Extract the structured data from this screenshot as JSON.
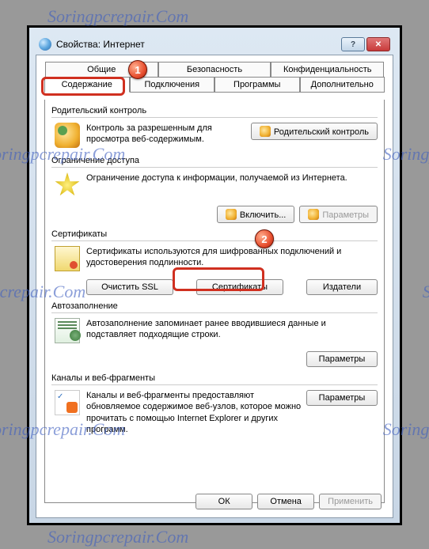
{
  "watermark": "Soringpcrepair.Com",
  "title": "Свойства: Интернет",
  "callouts": {
    "one": "1",
    "two": "2"
  },
  "tabs": {
    "general": "Общие",
    "security": "Безопасность",
    "privacy": "Конфиденциальность",
    "content": "Содержание",
    "connections": "Подключения",
    "programs": "Программы",
    "advanced": "Дополнительно"
  },
  "parental": {
    "header": "Родительский контроль",
    "text": "Контроль за разрешенным для просмотра веб-содержимым.",
    "button": "Родительский контроль"
  },
  "restrict": {
    "header": "Ограничение доступа",
    "text": "Ограничение доступа к информации, получаемой из Интернета.",
    "enable": "Включить...",
    "params": "Параметры"
  },
  "certs": {
    "header": "Сертификаты",
    "text": "Сертификаты используются для шифрованных подключений и удостоверения подлинности.",
    "clearssl": "Очистить SSL",
    "certs": "Сертификаты",
    "publishers": "Издатели"
  },
  "autofill": {
    "header": "Автозаполнение",
    "text": "Автозаполнение запоминает ранее вводившиеся данные и подставляет подходящие строки.",
    "params": "Параметры"
  },
  "feeds": {
    "header": "Каналы и веб-фрагменты",
    "text": "Каналы и веб-фрагменты предоставляют обновляемое содержимое веб-узлов, которое можно прочитать с помощью Internet Explorer и других программ.",
    "params": "Параметры"
  },
  "footer": {
    "ok": "ОК",
    "cancel": "Отмена",
    "apply": "Применить"
  }
}
